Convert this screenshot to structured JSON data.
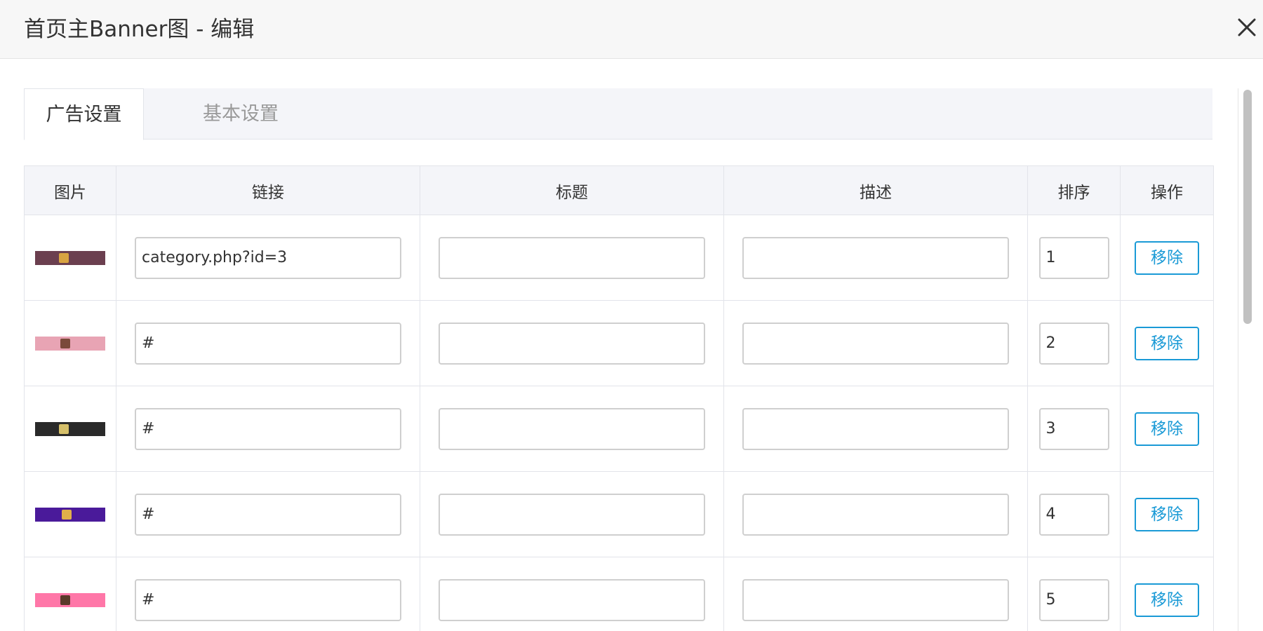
{
  "dialog": {
    "title": "首页主Banner图 - 编辑",
    "close_icon": "close-icon"
  },
  "tabs": [
    {
      "label": "广告设置",
      "active": true
    },
    {
      "label": "基本设置",
      "active": false
    }
  ],
  "table": {
    "headers": [
      "图片",
      "链接",
      "标题",
      "描述",
      "排序",
      "操作"
    ],
    "rows": [
      {
        "link": "category.php?id=3",
        "title": "",
        "description": "",
        "sort": "1",
        "action": "移除",
        "thumb_color": "#6b3f4f",
        "spot_color": "#d9a441"
      },
      {
        "link": "#",
        "title": "",
        "description": "",
        "sort": "2",
        "action": "移除",
        "thumb_color": "#e8a4b4",
        "spot_color": "#7a4a3a"
      },
      {
        "link": "#",
        "title": "",
        "description": "",
        "sort": "3",
        "action": "移除",
        "thumb_color": "#2a2a2a",
        "spot_color": "#d6c06a"
      },
      {
        "link": "#",
        "title": "",
        "description": "",
        "sort": "4",
        "action": "移除",
        "thumb_color": "#4a1a9a",
        "spot_color": "#e0b04a"
      },
      {
        "link": "#",
        "title": "",
        "description": "",
        "sort": "5",
        "action": "移除",
        "thumb_color": "#ff77a8",
        "spot_color": "#5a3a2a"
      }
    ]
  },
  "colors": {
    "accent": "#1a9ad6",
    "header_bg": "#f7f7f7",
    "tab_bg": "#f4f5f9",
    "border": "#e2e4ea"
  }
}
